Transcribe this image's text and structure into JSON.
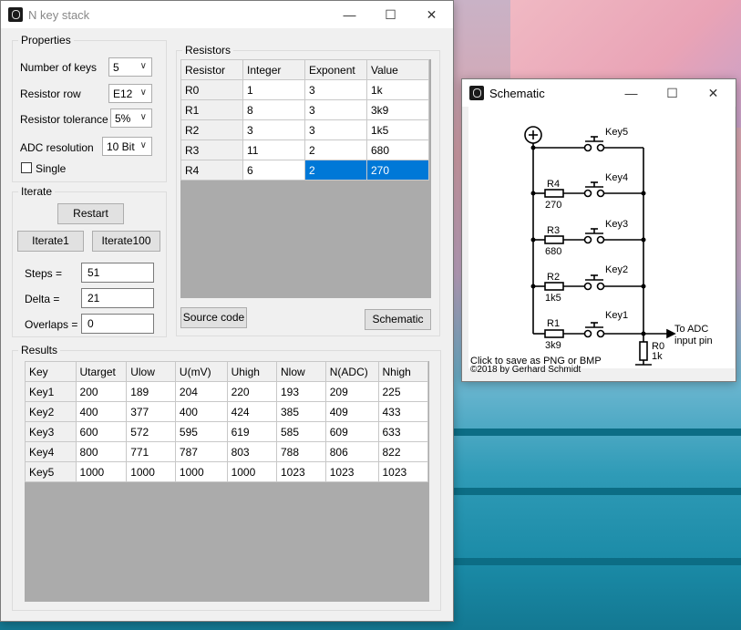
{
  "main_window": {
    "title": "N key stack",
    "properties": {
      "group_label": "Properties",
      "number_of_keys_label": "Number of keys",
      "number_of_keys_value": "5",
      "resistor_row_label": "Resistor row",
      "resistor_row_value": "E12",
      "resistor_tolerance_label": "Resistor tolerance",
      "resistor_tolerance_value": "5%",
      "adc_resolution_label": "ADC resolution",
      "adc_resolution_value": "10 Bit",
      "single_label": "Single",
      "single_checked": false
    },
    "iterate": {
      "group_label": "Iterate",
      "restart_label": "Restart",
      "iterate1_label": "Iterate1",
      "iterate100_label": "Iterate100",
      "steps_label": "Steps =",
      "steps_value": "51",
      "delta_label": "Delta =",
      "delta_value": "21",
      "overlaps_label": "Overlaps =",
      "overlaps_value": "0"
    },
    "resistors": {
      "group_label": "Resistors",
      "columns": [
        "Resistor",
        "Integer",
        "Exponent",
        "Value"
      ],
      "rows": [
        [
          "R0",
          "1",
          "3",
          "1k"
        ],
        [
          "R1",
          "8",
          "3",
          "3k9"
        ],
        [
          "R2",
          "3",
          "3",
          "1k5"
        ],
        [
          "R3",
          "11",
          "2",
          "680"
        ],
        [
          "R4",
          "6",
          "2",
          "270"
        ]
      ],
      "source_code_label": "Source code",
      "schematic_label": "Schematic"
    },
    "results": {
      "group_label": "Results",
      "columns": [
        "Key",
        "Utarget",
        "Ulow",
        "U(mV)",
        "Uhigh",
        "Nlow",
        "N(ADC)",
        "Nhigh"
      ],
      "rows": [
        [
          "Key1",
          "200",
          "189",
          "204",
          "220",
          "193",
          "209",
          "225"
        ],
        [
          "Key2",
          "400",
          "377",
          "400",
          "424",
          "385",
          "409",
          "433"
        ],
        [
          "Key3",
          "600",
          "572",
          "595",
          "619",
          "585",
          "609",
          "633"
        ],
        [
          "Key4",
          "800",
          "771",
          "787",
          "803",
          "788",
          "806",
          "822"
        ],
        [
          "Key5",
          "1000",
          "1000",
          "1000",
          "1000",
          "1023",
          "1023",
          "1023"
        ]
      ]
    }
  },
  "schematic_window": {
    "title": "Schematic",
    "keys": [
      "Key5",
      "Key4",
      "Key3",
      "Key2",
      "Key1"
    ],
    "resistor_names": [
      "R4",
      "R3",
      "R2",
      "R1"
    ],
    "resistor_values": [
      "270",
      "680",
      "1k5",
      "3k9"
    ],
    "r0_name": "R0",
    "r0_value": "1k",
    "adc_label_1": "To ADC",
    "adc_label_2": "input pin",
    "footer_1": "Click to save as PNG or BMP",
    "footer_2": "©2018 by Gerhard Schmidt"
  },
  "window_controls": {
    "minimize": "—",
    "maximize": "☐",
    "close": "✕"
  }
}
